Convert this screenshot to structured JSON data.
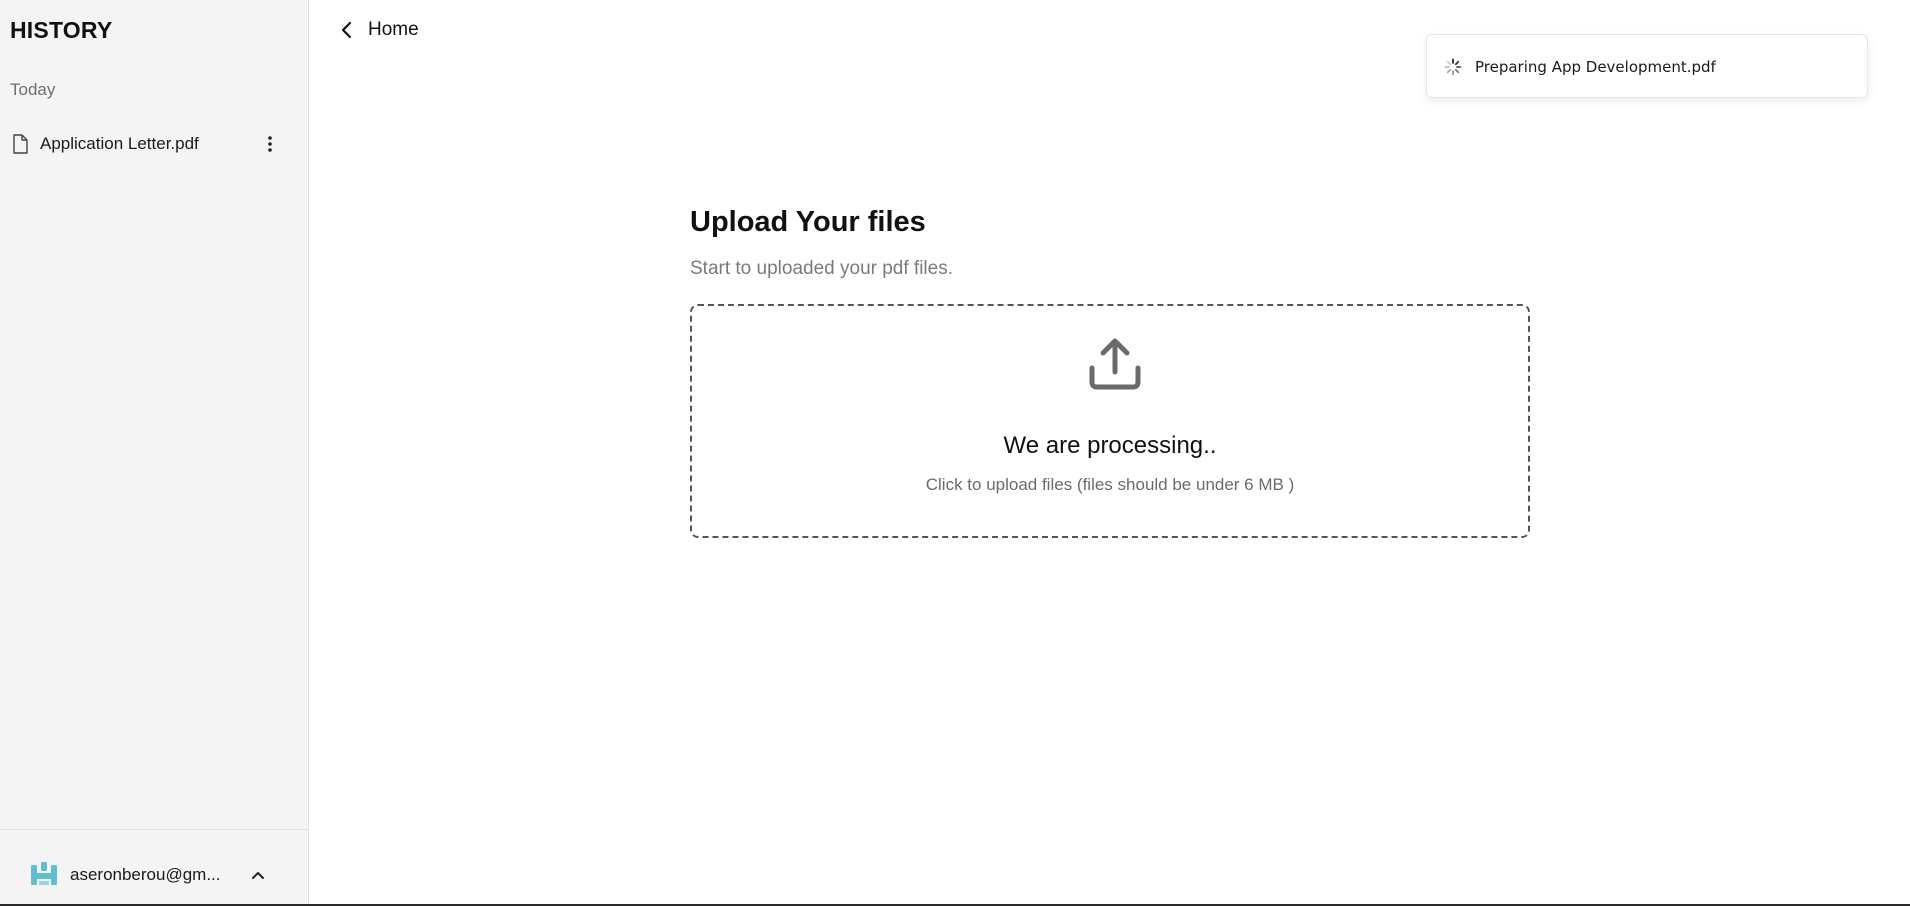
{
  "sidebar": {
    "title": "HISTORY",
    "section_label": "Today",
    "items": [
      {
        "label": "Application Letter.pdf",
        "icon": "file-icon"
      }
    ],
    "user": {
      "email": "aseronberou@gm...",
      "avatar_color": "#5fbfcf"
    }
  },
  "header": {
    "back_label": "Home"
  },
  "toast": {
    "text": "Preparing App Development.pdf",
    "icon": "spinner-icon"
  },
  "upload": {
    "heading": "Upload Your files",
    "subheading": "Start to uploaded your pdf files.",
    "status": "We are processing..",
    "hint": "Click to upload files (files should be under 6 MB )"
  },
  "colors": {
    "sidebar_bg": "#f4f4f4",
    "muted_text": "#7a7a7a",
    "dropzone_border": "#555555"
  }
}
